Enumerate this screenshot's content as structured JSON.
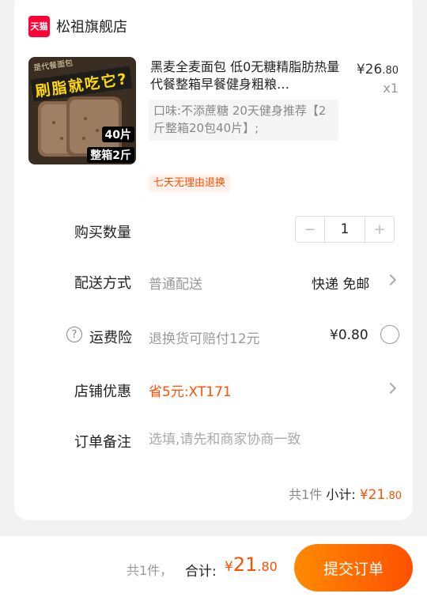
{
  "store": {
    "badge": "天猫",
    "name": "松祖旗舰店"
  },
  "product": {
    "image_topline": "是代餐面包",
    "image_overlay": "刷脂就吃它?",
    "image_tag_count": "40片",
    "image_tag_box": "整箱2斤",
    "title": "黑麦全麦面包 低0无糖精脂肪热量代餐整箱早餐健身粗粮…",
    "price_symbol": "¥",
    "price_int": "26",
    "price_dec": ".80",
    "quantity_label": "x1",
    "spec": "口味:不添蔗糖  20天健身推荐【2斤整箱20包40片】;",
    "return_badge": "七天无理由退换"
  },
  "rows": {
    "quantity": {
      "label": "购买数量",
      "value": "1",
      "minus": "−",
      "plus": "+"
    },
    "delivery": {
      "label": "配送方式",
      "sub": "普通配送",
      "value": "快递 免邮"
    },
    "insurance": {
      "label": "运费险",
      "help": "?",
      "sub": "退换货可赔付12元",
      "value": "¥0.80"
    },
    "discount": {
      "label": "店铺优惠",
      "coupon": "省5元:XT171"
    },
    "note": {
      "label": "订单备注",
      "placeholder": "选填,请先和商家协商一致"
    }
  },
  "subtotal": {
    "count": "共1件",
    "label": "小计:",
    "symbol": "¥",
    "int": "21",
    "dec": ".80"
  },
  "footer": {
    "count": "共1件，",
    "total_label": "合计:",
    "symbol": "¥",
    "int": "21",
    "dec": ".80",
    "submit": "提交订单"
  },
  "colors": {
    "accent": "#ff5000",
    "tmall": "#ff0036"
  }
}
